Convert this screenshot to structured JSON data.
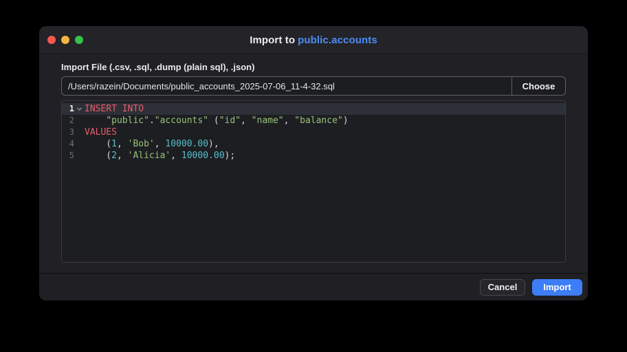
{
  "window": {
    "title_prefix": "Import to",
    "title_highlight": "public.accounts"
  },
  "form": {
    "label": "Import File (.csv, .sql, .dump (plain sql), .json)",
    "path_value": "/Users/razein/Documents/public_accounts_2025-07-06_11-4-32.sql",
    "choose_label": "Choose"
  },
  "editor": {
    "lines": [
      {
        "number": "1",
        "active": true,
        "fold": true,
        "segments": [
          {
            "t": "INSERT INTO",
            "c": "keyword"
          }
        ]
      },
      {
        "number": "2",
        "active": false,
        "fold": false,
        "segments": [
          {
            "t": "    ",
            "c": "plain"
          },
          {
            "t": "\"public\"",
            "c": "string"
          },
          {
            "t": ".",
            "c": "plain"
          },
          {
            "t": "\"accounts\"",
            "c": "string"
          },
          {
            "t": " (",
            "c": "plain"
          },
          {
            "t": "\"id\"",
            "c": "string"
          },
          {
            "t": ", ",
            "c": "plain"
          },
          {
            "t": "\"name\"",
            "c": "string"
          },
          {
            "t": ", ",
            "c": "plain"
          },
          {
            "t": "\"balance\"",
            "c": "string"
          },
          {
            "t": ")",
            "c": "plain"
          }
        ]
      },
      {
        "number": "3",
        "active": false,
        "fold": false,
        "segments": [
          {
            "t": "VALUES",
            "c": "keyword"
          }
        ]
      },
      {
        "number": "4",
        "active": false,
        "fold": false,
        "segments": [
          {
            "t": "    (",
            "c": "plain"
          },
          {
            "t": "1",
            "c": "number"
          },
          {
            "t": ", ",
            "c": "plain"
          },
          {
            "t": "'Bob'",
            "c": "string"
          },
          {
            "t": ", ",
            "c": "plain"
          },
          {
            "t": "10000.00",
            "c": "number"
          },
          {
            "t": "),",
            "c": "plain"
          }
        ]
      },
      {
        "number": "5",
        "active": false,
        "fold": false,
        "segments": [
          {
            "t": "    (",
            "c": "plain"
          },
          {
            "t": "2",
            "c": "number"
          },
          {
            "t": ", ",
            "c": "plain"
          },
          {
            "t": "'Alicia'",
            "c": "string"
          },
          {
            "t": ", ",
            "c": "plain"
          },
          {
            "t": "10000.00",
            "c": "number"
          },
          {
            "t": ");",
            "c": "plain"
          }
        ]
      }
    ]
  },
  "footer": {
    "cancel_label": "Cancel",
    "import_label": "Import"
  },
  "colors": {
    "keyword": "#e85d6b",
    "string": "#98c379",
    "number": "#55c0cc",
    "plain": "#d6d7d9",
    "accent_blue": "#3d7df6",
    "title_highlight": "#4e8ef4",
    "tl_close": "#f5584e",
    "tl_minimize": "#f3b53d",
    "tl_zoom": "#36c24b"
  }
}
